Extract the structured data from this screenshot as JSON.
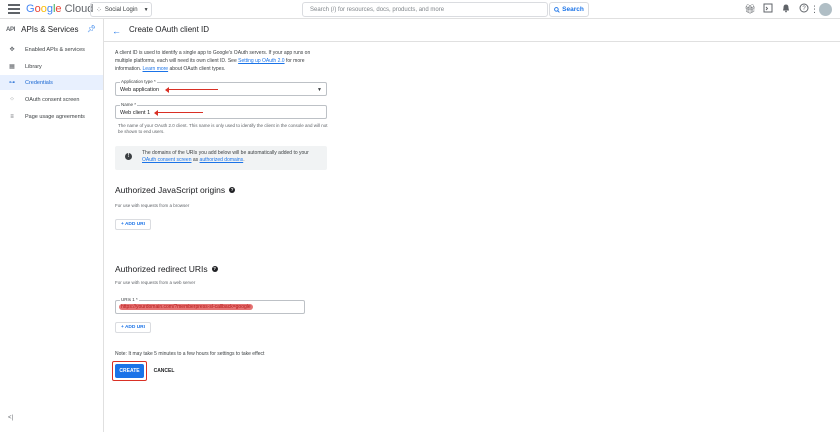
{
  "topbar": {
    "logo_parts": [
      "G",
      "o",
      "o",
      "g",
      "l",
      "e"
    ],
    "logo_cloud": "Cloud",
    "project_name": "Social Login",
    "search_placeholder": "Search (/) for resources, docs, products, and more",
    "search_button": "Search",
    "icons": [
      "gift-icon",
      "terminal-icon",
      "bell-icon",
      "help-icon",
      "more-vert-icon",
      "avatar"
    ]
  },
  "sidebar": {
    "header_badge": "API",
    "header_title": "APIs & Services",
    "items": [
      {
        "icon": "diamond-icon",
        "label": "Enabled APIs & services"
      },
      {
        "icon": "library-icon",
        "label": "Library"
      },
      {
        "icon": "key-icon",
        "label": "Credentials",
        "active": true
      },
      {
        "icon": "consent-icon",
        "label": "OAuth consent screen"
      },
      {
        "icon": "agreements-icon",
        "label": "Page usage agreements"
      }
    ],
    "collapse": "<|"
  },
  "main": {
    "title": "Create OAuth client ID",
    "intro_text": "A client ID is used to identify a single app to Google's OAuth servers. If your app runs on multiple platforms, each will need its own client ID. See ",
    "intro_link1": "Setting up OAuth 2.0",
    "intro_mid": " for more information. ",
    "intro_link2": "Learn more",
    "intro_end": " about OAuth client types.",
    "app_type_label": "Application type *",
    "app_type_value": "Web application",
    "name_label": "Name *",
    "name_value": "Web client 1",
    "name_hint": "The name of your OAuth 2.0 client. This name is only used to identify the client in the console and will not be shown to end users.",
    "info_text1": "The domains of the URIs you add below will be automatically added to your ",
    "info_link1": "OAuth consent screen",
    "info_mid": " as ",
    "info_link2": "authorized domains",
    "info_end": ".",
    "js_origins_title": "Authorized JavaScript origins",
    "js_origins_sub": "For use with requests from a browser",
    "add_uri": "+ ADD URI",
    "redirect_title": "Authorized redirect URIs",
    "redirect_sub": "For use with requests from a web server",
    "uri_label": "URIs 1 *",
    "uri_value": "https://yourdomain.com/?memberpress-sl-callback=google",
    "note": "Note: It may take 5 minutes to a few hours for settings to take effect",
    "create": "CREATE",
    "cancel": "CANCEL"
  },
  "colors": {
    "accent": "#1a73e8",
    "annotation": "#d93025",
    "active_bg": "#e8f0fe"
  }
}
